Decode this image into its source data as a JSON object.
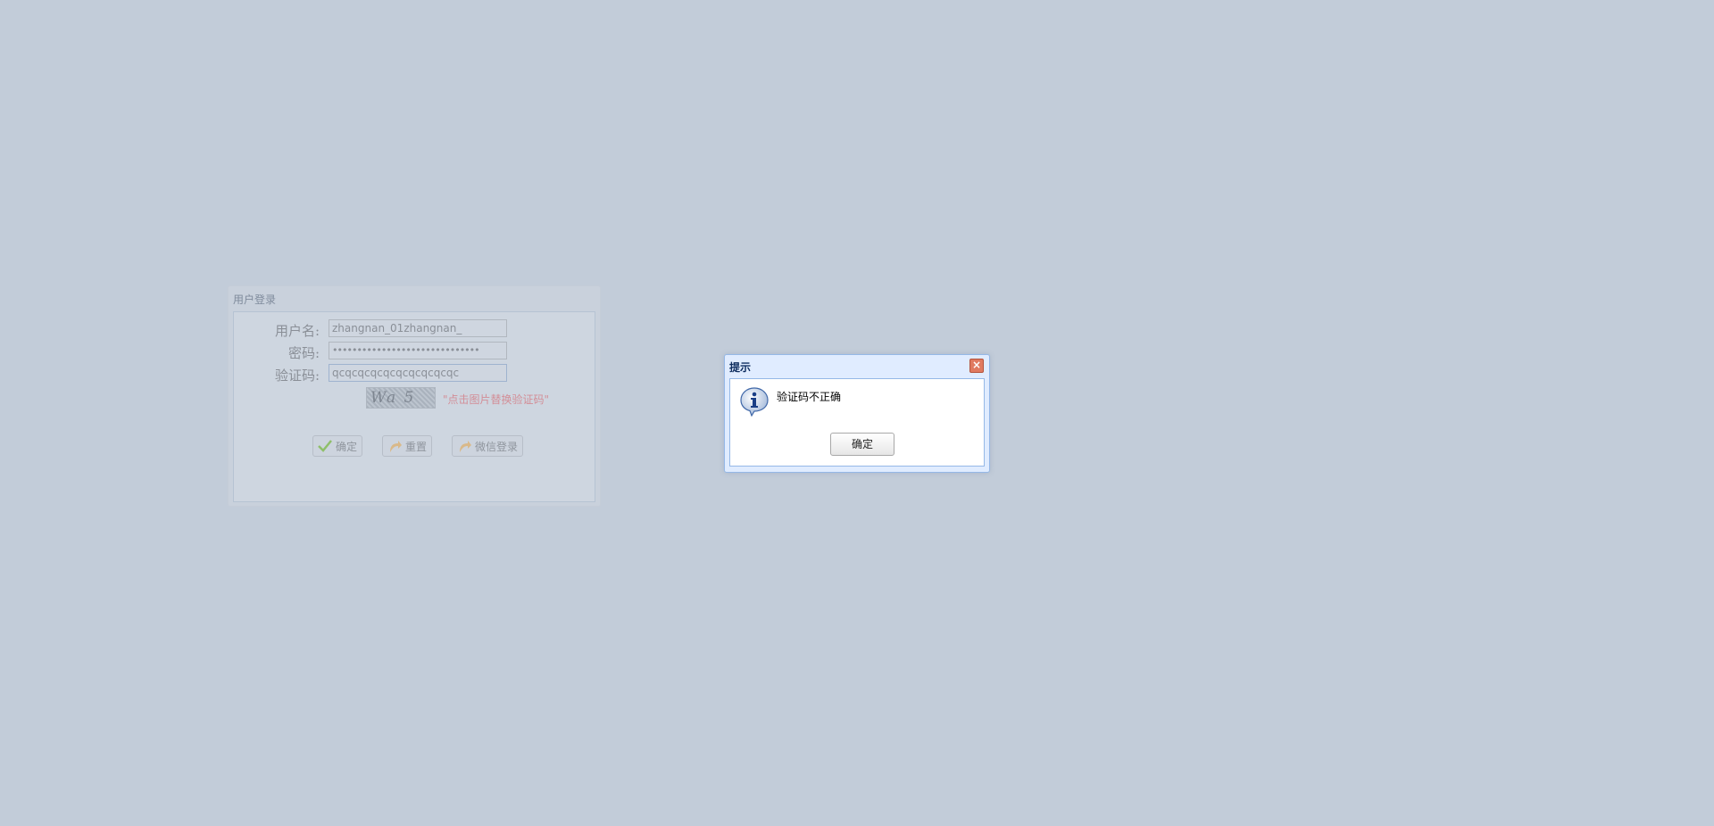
{
  "login": {
    "title": "用户登录",
    "username_label": "用户名:",
    "username_value": "zhangnan_01zhangnan_",
    "password_label": "密码:",
    "password_value": "••••••••••••••••••••••••••••••",
    "captcha_label": "验证码:",
    "captcha_value": "qcqcqcqcqcqcqcqcqcqc",
    "captcha_hint": "\"点击图片替换验证码\"",
    "buttons": {
      "confirm": "确定",
      "reset": "重置",
      "wechat": "微信登录"
    }
  },
  "dialog": {
    "title": "提示",
    "message": "验证码不正确",
    "ok_label": "确定"
  }
}
